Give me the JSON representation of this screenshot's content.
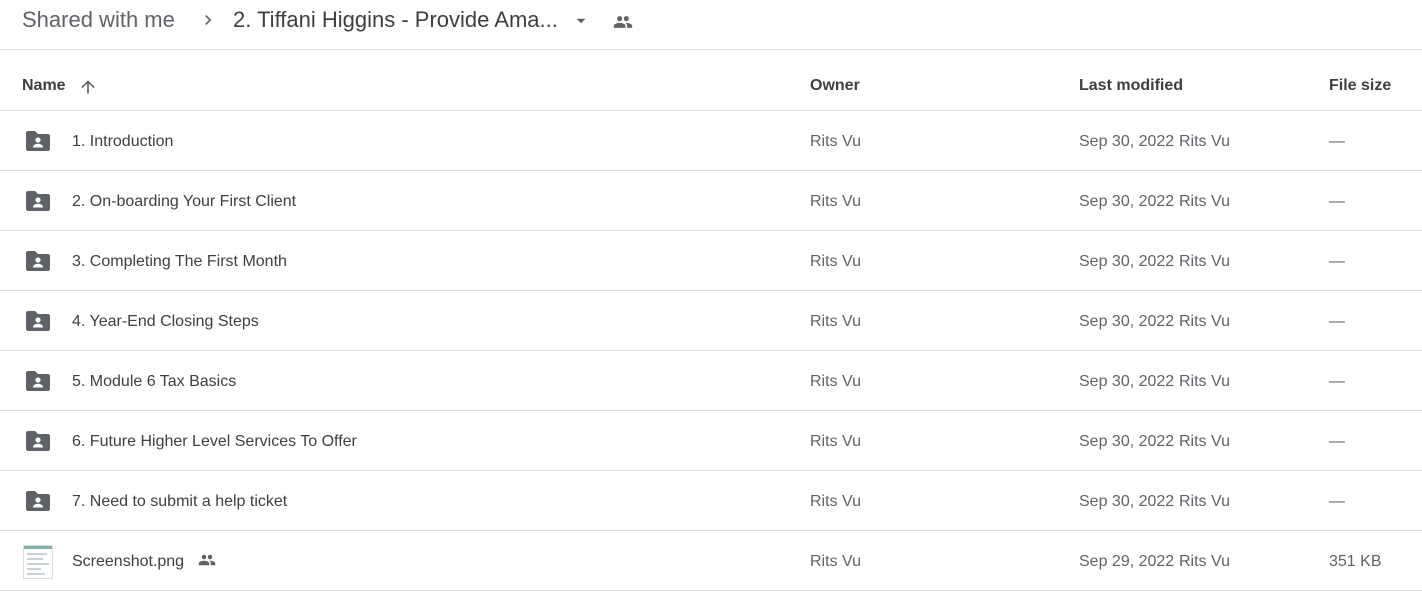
{
  "breadcrumb": {
    "root": "Shared with me",
    "current": "2. Tiffani Higgins - Provide Ama..."
  },
  "columns": {
    "name": "Name",
    "owner": "Owner",
    "last_modified": "Last modified",
    "file_size": "File size"
  },
  "icons": {
    "separator": "chevron-right-icon",
    "dropdown": "caret-down-icon",
    "shared": "people-icon",
    "sort": "arrow-up-icon",
    "folder": "shared-folder-icon",
    "image": "image-thumbnail"
  },
  "colors": {
    "icon_gray": "#5f6368",
    "divider": "#dadce0",
    "text_primary": "#3c4043"
  },
  "files": [
    {
      "name": "1. Introduction",
      "owner": "Rits Vu",
      "modified_date": "Sep 30, 2022",
      "modified_by": "Rits Vu",
      "size": "—",
      "type": "folder"
    },
    {
      "name": "2. On-boarding Your First Client",
      "owner": "Rits Vu",
      "modified_date": "Sep 30, 2022",
      "modified_by": "Rits Vu",
      "size": "—",
      "type": "folder"
    },
    {
      "name": "3. Completing The First Month",
      "owner": "Rits Vu",
      "modified_date": "Sep 30, 2022",
      "modified_by": "Rits Vu",
      "size": "—",
      "type": "folder"
    },
    {
      "name": "4. Year-End Closing Steps",
      "owner": "Rits Vu",
      "modified_date": "Sep 30, 2022",
      "modified_by": "Rits Vu",
      "size": "—",
      "type": "folder"
    },
    {
      "name": "5. Module 6 Tax Basics",
      "owner": "Rits Vu",
      "modified_date": "Sep 30, 2022",
      "modified_by": "Rits Vu",
      "size": "—",
      "type": "folder"
    },
    {
      "name": "6. Future Higher Level Services To Offer",
      "owner": "Rits Vu",
      "modified_date": "Sep 30, 2022",
      "modified_by": "Rits Vu",
      "size": "—",
      "type": "folder"
    },
    {
      "name": "7. Need to submit a help ticket",
      "owner": "Rits Vu",
      "modified_date": "Sep 30, 2022",
      "modified_by": "Rits Vu",
      "size": "—",
      "type": "folder"
    },
    {
      "name": "Screenshot.png",
      "owner": "Rits Vu",
      "modified_date": "Sep 29, 2022",
      "modified_by": "Rits Vu",
      "size": "351 KB",
      "type": "image",
      "shared": true
    }
  ]
}
